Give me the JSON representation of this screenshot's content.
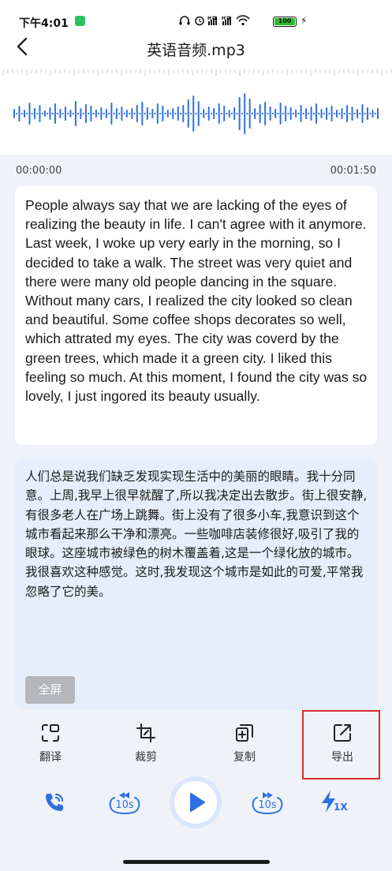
{
  "status_bar": {
    "time": "下午4:01",
    "signal_text": "ᑎ ⏰ ᴴᴰ𝗂𝗅𝗅 ᴴᴰ𝗂𝗅𝗅 ≋",
    "battery": "100",
    "icons": [
      "headphone-icon",
      "alarm-icon",
      "signal-icon",
      "signal-icon",
      "wifi-icon",
      "battery-icon",
      "charging-icon"
    ]
  },
  "nav": {
    "back_icon": "back-arrow-icon",
    "title": "英语音频.mp3"
  },
  "waveform": {
    "accent": "#2e6fe3",
    "played_fraction": 0
  },
  "timeline": {
    "start": "00:00:00",
    "end": "00:01:50"
  },
  "english_text": "People always say that we are lacking of the eyes of realizing the beauty in life. I can't agree with it anymore. Last week, I woke up very early in the morning, so I decided to take a walk. The street was very quiet and there were many old people dancing in the square. Without many cars, I realized the city looked so clean and beautiful. Some coffee shops decorates so well, which attrated my eyes. The city was coverd by the green trees, which made it a green city. I liked this feeling so much. At this moment, I found the city was so lovely, I just ingored its beauty usually.",
  "chinese_text": "人们总是说我们缺乏发现实现生活中的美丽的眼睛。我十分同意。上周,我早上很早就醒了,所以我决定出去散步。街上很安静,有很多老人在广场上跳舞。街上没有了很多小车,我意识到这个城市看起来那么干净和漂亮。一些咖啡店装修很好,吸引了我的眼球。这座城市被绿色的树木覆盖着,这是一个绿化放的城市。我很喜欢这种感觉。这时,我发现这个城市是如此的可爱,平常我忽略了它的美。",
  "fullscreen_label": "全屏",
  "tools": [
    {
      "label": "翻译",
      "icon": "translate-icon"
    },
    {
      "label": "裁剪",
      "icon": "crop-icon"
    },
    {
      "label": "复制",
      "icon": "copy-icon"
    },
    {
      "label": "导出",
      "icon": "export-icon"
    }
  ],
  "player": {
    "rewind_label": "10s",
    "forward_label": "10s",
    "speed_label": "1X",
    "icons": [
      "phone-icon",
      "rewind-10s-icon",
      "play-icon",
      "forward-10s-icon",
      "speed-icon"
    ],
    "accent": "#2e6fe3"
  },
  "colors": {
    "accent": "#2e6fe3",
    "highlight_border": "#d42b2b",
    "translation_bg": "#e6eefb"
  }
}
